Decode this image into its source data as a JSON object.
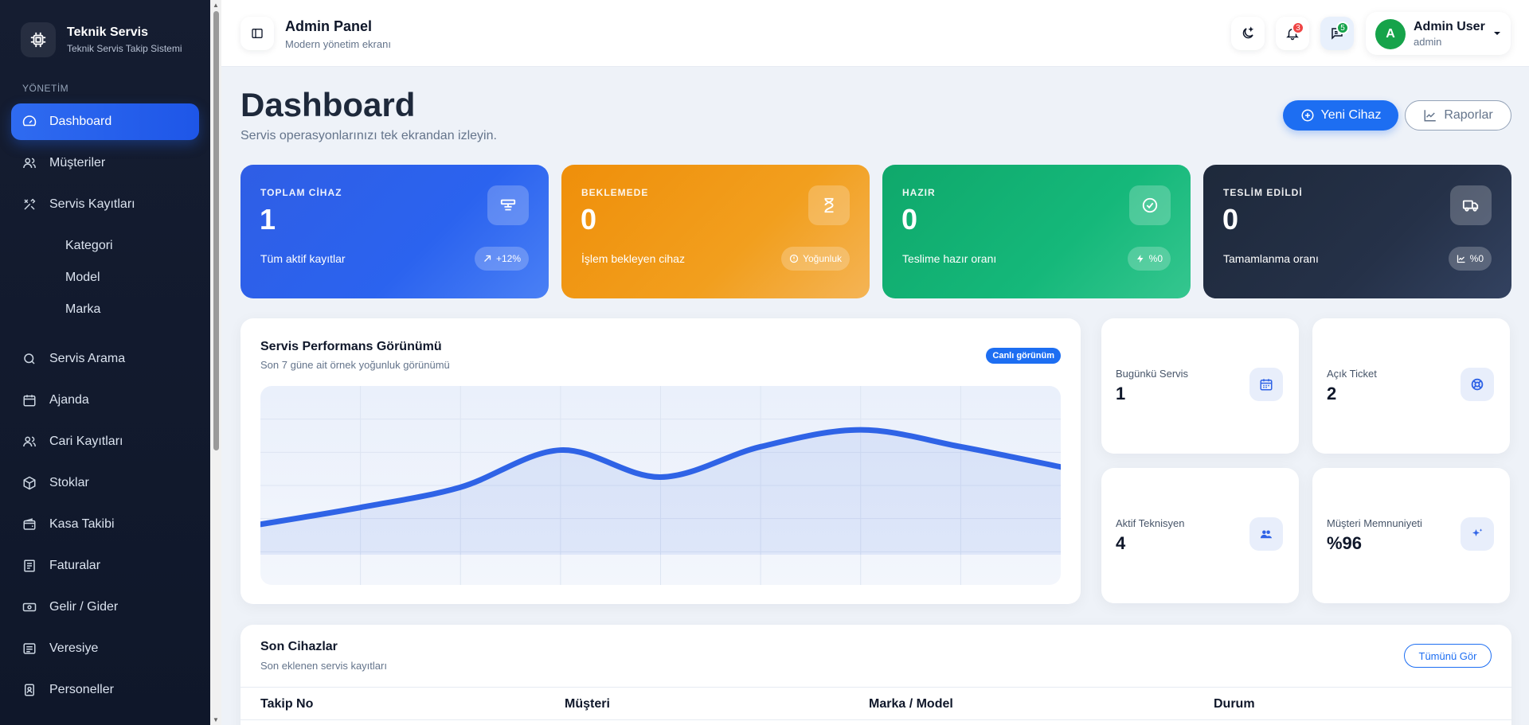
{
  "brand": {
    "title": "Teknik Servis",
    "subtitle": "Teknik Servis Takip Sistemi"
  },
  "sidebar": {
    "section_label": "YÖNETİM",
    "items": [
      {
        "label": "Dashboard",
        "icon": "gauge-icon",
        "active": true
      },
      {
        "label": "Müşteriler",
        "icon": "users-icon"
      },
      {
        "label": "Servis Kayıtları",
        "icon": "tools-icon"
      },
      {
        "label": "Servis Arama",
        "icon": "search-icon"
      },
      {
        "label": "Ajanda",
        "icon": "calendar-icon"
      },
      {
        "label": "Cari Kayıtları",
        "icon": "users-icon"
      },
      {
        "label": "Stoklar",
        "icon": "box-icon"
      },
      {
        "label": "Kasa Takibi",
        "icon": "wallet-icon"
      },
      {
        "label": "Faturalar",
        "icon": "invoice-icon"
      },
      {
        "label": "Gelir / Gider",
        "icon": "cash-icon"
      },
      {
        "label": "Veresiye",
        "icon": "ledger-icon"
      },
      {
        "label": "Personeller",
        "icon": "badge-icon"
      }
    ],
    "sub_items": [
      "Kategori",
      "Model",
      "Marka"
    ]
  },
  "header": {
    "title": "Admin Panel",
    "subtitle": "Modern yönetim ekranı",
    "notifications_count": "3",
    "messages_count": "5",
    "user_name": "Admin User",
    "user_role": "admin",
    "user_initial": "A"
  },
  "page": {
    "title": "Dashboard",
    "subtitle": "Servis operasyonlarınızı tek ekrandan izleyin.",
    "new_device_label": "Yeni Cihaz",
    "reports_label": "Raporlar"
  },
  "stats": [
    {
      "label": "TOPLAM CİHAZ",
      "value": "1",
      "foot": "Tüm aktif kayıtlar",
      "pill": "+12%",
      "icon": "devices-icon",
      "color": "#2b63ef"
    },
    {
      "label": "BEKLEMEDE",
      "value": "0",
      "foot": "İşlem bekleyen cihaz",
      "pill": "Yoğunluk",
      "icon": "hourglass-icon",
      "color": "#f29f1e"
    },
    {
      "label": "HAZIR",
      "value": "0",
      "foot": "Teslime hazır oranı",
      "pill": "%0",
      "icon": "check-badge-icon",
      "color": "#15b87a"
    },
    {
      "label": "TESLİM EDİLDİ",
      "value": "0",
      "foot": "Tamamlanma oranı",
      "pill": "%0",
      "icon": "truck-icon",
      "color": "#253148"
    }
  ],
  "performance": {
    "title": "Servis Performans Görünümü",
    "subtitle": "Son 7 güne ait örnek yoğunluk görünümü",
    "badge": "Canlı görünüm"
  },
  "chart_data": {
    "type": "area",
    "x": [
      0,
      1,
      2,
      3,
      4,
      5,
      6,
      7,
      8
    ],
    "values": [
      18,
      28,
      40,
      62,
      46,
      64,
      74,
      64,
      52
    ],
    "ylim": [
      0,
      100
    ],
    "grid": true,
    "color": "#2f63e6"
  },
  "mini_cards": [
    {
      "label": "Bugünkü Servis",
      "value": "1",
      "icon": "calendar-icon"
    },
    {
      "label": "Açık Ticket",
      "value": "2",
      "icon": "lifebuoy-icon"
    },
    {
      "label": "Aktif Teknisyen",
      "value": "4",
      "icon": "team-icon"
    },
    {
      "label": "Müşteri Memnuniyeti",
      "value": "%96",
      "icon": "sparkle-icon"
    }
  ],
  "recent": {
    "title": "Son Cihazlar",
    "subtitle": "Son eklenen servis kayıtları",
    "view_all": "Tümünü Gör",
    "columns": [
      "Takip No",
      "Müşteri",
      "Marka / Model",
      "Durum"
    ]
  }
}
